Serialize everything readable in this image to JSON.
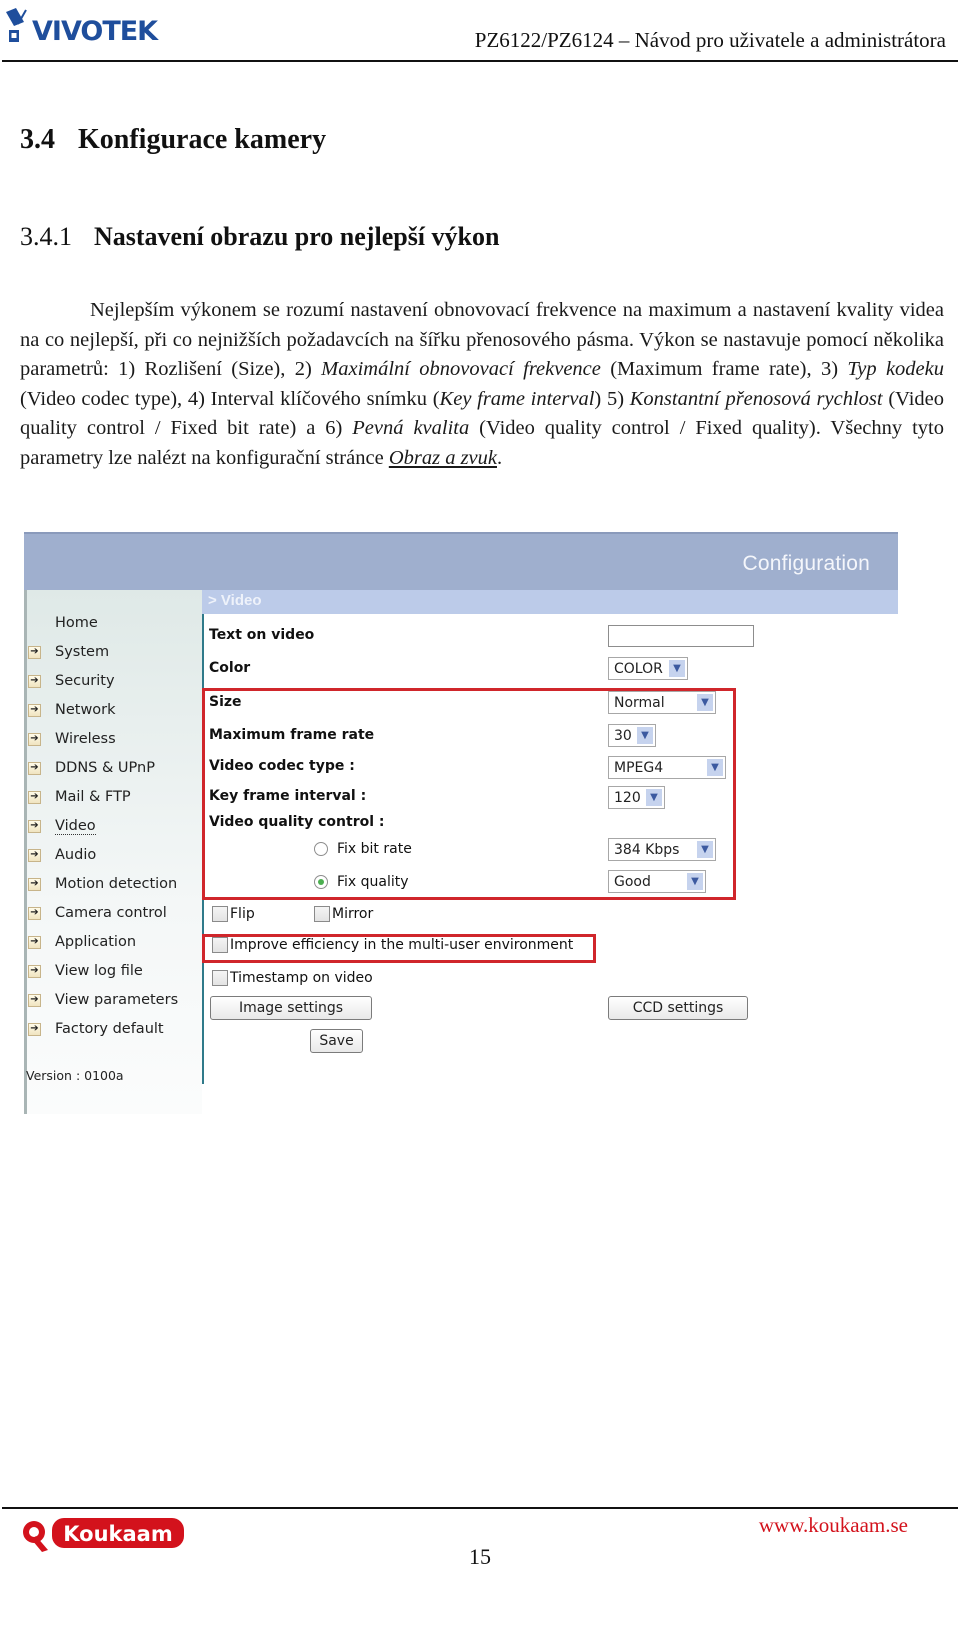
{
  "header": {
    "brand": "VIVOTEK",
    "title": "PZ6122/PZ6124 – Návod pro uživatele a administrátora"
  },
  "section": {
    "number": "3.4",
    "title": "Konfigurace kamery"
  },
  "subsection": {
    "number": "3.4.1",
    "title": "Nastavení obrazu pro nejlepší výkon"
  },
  "paragraph": {
    "p1": "Nejlepším výkonem se rozumí nastavení obnovovací frekvence na maximum a nastavení kvality videa na co nejlepší, při co nejnižších požadavcích na šířku přenosového pásma. Výkon se nastavuje pomocí několika parametrů: 1) Rozlišení (Size), 2) ",
    "i1": "Maximální obnovovací frekvence",
    "p2": " (Maximum frame rate), 3) ",
    "i2": "Typ kodeku",
    "p3": " (Video codec type), 4) Interval klíčového snímku (",
    "i3": "Key frame interval",
    "p4": ") 5) ",
    "i4": "Konstantní přenosová rychlost",
    "p5": " (Video quality control / Fixed bit rate) a 6) ",
    "i5": "Pevná kvalita",
    "p6": " (Video quality control / Fixed quality). Všechny tyto parametry lze nalézt na konfigurační stránce ",
    "link": "Obraz a zvuk",
    "p7": "."
  },
  "screenshot": {
    "top_title": "Configuration",
    "section_title": "> Video",
    "nav": [
      {
        "label": "Home",
        "arrow": false
      },
      {
        "label": "System",
        "arrow": true
      },
      {
        "label": "Security",
        "arrow": true
      },
      {
        "label": "Network",
        "arrow": true
      },
      {
        "label": "Wireless",
        "arrow": true
      },
      {
        "label": "DDNS & UPnP",
        "arrow": true
      },
      {
        "label": "Mail & FTP",
        "arrow": true
      },
      {
        "label": "Video",
        "arrow": true,
        "active": true
      },
      {
        "label": "Audio",
        "arrow": true
      },
      {
        "label": "Motion detection",
        "arrow": true
      },
      {
        "label": "Camera control",
        "arrow": true
      },
      {
        "label": "Application",
        "arrow": true
      },
      {
        "label": "View log file",
        "arrow": true
      },
      {
        "label": "View parameters",
        "arrow": true
      },
      {
        "label": "Factory default",
        "arrow": true
      }
    ],
    "version": "Version : 0100a",
    "form": {
      "text_on_video_label": "Text on video",
      "text_on_video_value": "",
      "color_label": "Color",
      "color_value": "COLOR",
      "size_label": "Size",
      "size_value": "Normal",
      "max_frame_rate_label": "Maximum frame rate",
      "max_frame_rate_value": "30",
      "codec_label": "Video codec type :",
      "codec_value": "MPEG4",
      "key_frame_label": "Key frame interval :",
      "key_frame_value": "120",
      "quality_control_label": "Video quality control :",
      "fix_bit_rate_label": "Fix bit rate",
      "fix_bit_rate_value": "384 Kbps",
      "fix_bit_rate_selected": false,
      "fix_quality_label": "Fix quality",
      "fix_quality_value": "Good",
      "fix_quality_selected": true,
      "flip_label": "Flip",
      "flip_checked": false,
      "mirror_label": "Mirror",
      "mirror_checked": false,
      "improve_label": "Improve efficiency in the multi-user environment",
      "improve_checked": false,
      "timestamp_label": "Timestamp on video",
      "timestamp_checked": false,
      "image_settings_button": "Image settings",
      "ccd_settings_button": "CCD settings",
      "save_button": "Save"
    },
    "highlight_color": "#d0262b"
  },
  "footer": {
    "brand": "Koukaam",
    "url": "www.koukaam.se",
    "page_number": "15"
  }
}
